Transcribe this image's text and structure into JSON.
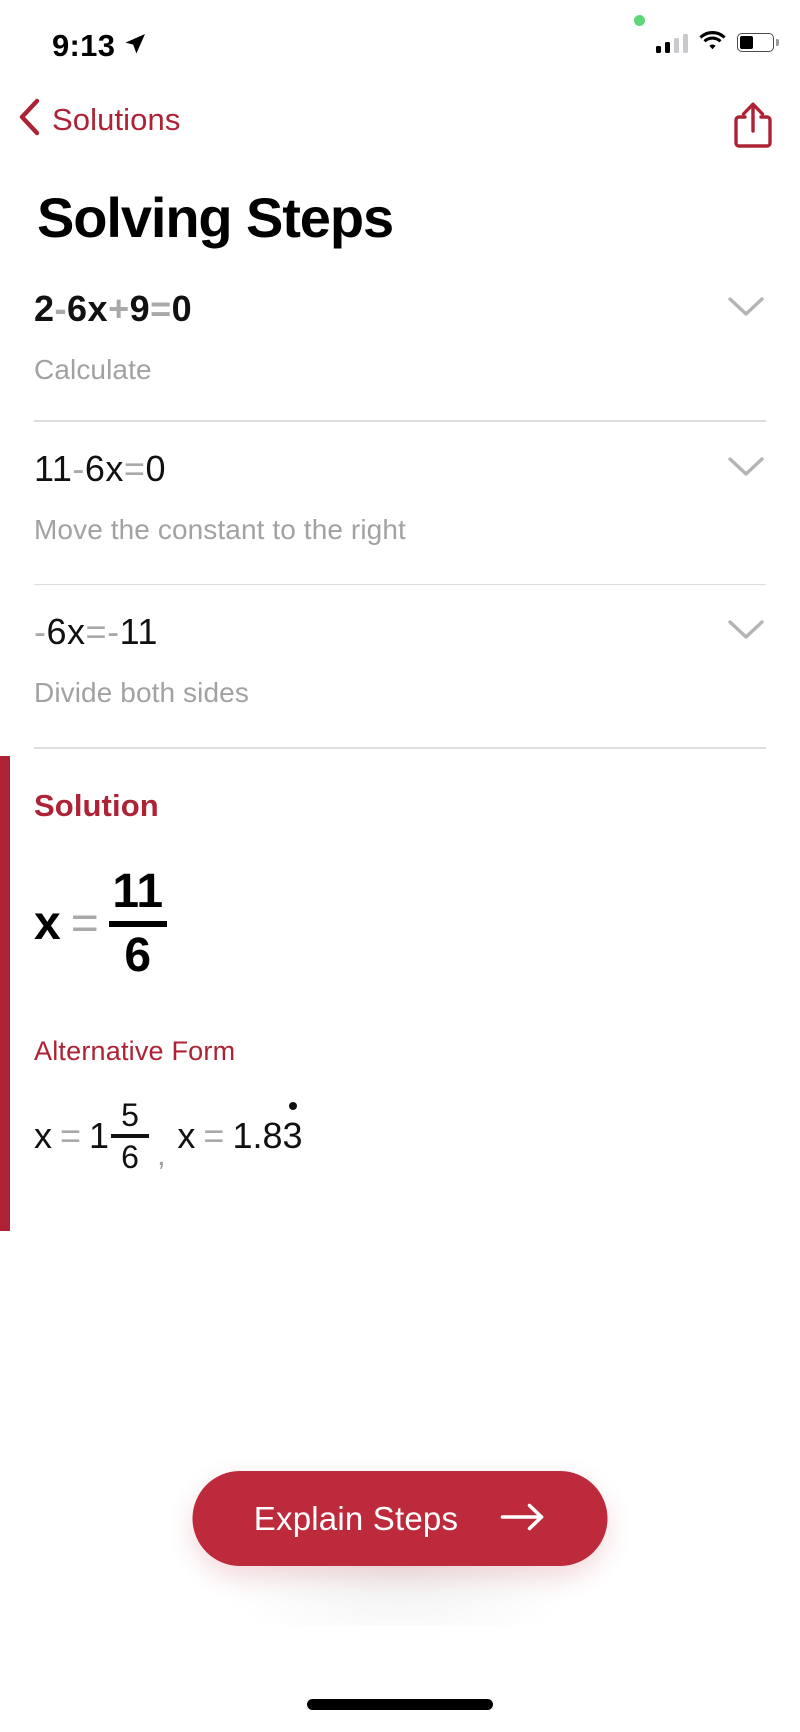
{
  "status_bar": {
    "time": "9:13",
    "location_icon": "location-arrow-icon",
    "recording_indicator": "green-dot-icon",
    "cellular_icon": "cellular-bars-icon",
    "wifi_icon": "wifi-icon",
    "battery_icon": "battery-icon"
  },
  "nav": {
    "back_label": "Solutions",
    "back_icon": "chevron-left-icon",
    "share_icon": "share-icon"
  },
  "page": {
    "title": "Solving Steps"
  },
  "steps": [
    {
      "equation": [
        {
          "t": "2",
          "k": "num"
        },
        {
          "t": "-",
          "k": "op"
        },
        {
          "t": "6x",
          "k": "num"
        },
        {
          "t": "+",
          "k": "op"
        },
        {
          "t": "9",
          "k": "num"
        },
        {
          "t": "=",
          "k": "op"
        },
        {
          "t": "0",
          "k": "num"
        }
      ],
      "equation_text": "2 - 6x + 9 = 0",
      "description": "Calculate",
      "expand_icon": "chevron-down-icon",
      "bold": true
    },
    {
      "equation": [
        {
          "t": "11",
          "k": "num"
        },
        {
          "t": "-",
          "k": "op"
        },
        {
          "t": "6x",
          "k": "num"
        },
        {
          "t": "=",
          "k": "op"
        },
        {
          "t": "0",
          "k": "num"
        }
      ],
      "equation_text": "11 - 6x = 0",
      "description": "Move the constant to the right",
      "expand_icon": "chevron-down-icon",
      "bold": false
    },
    {
      "equation": [
        {
          "t": "-",
          "k": "op"
        },
        {
          "t": "6x",
          "k": "num"
        },
        {
          "t": "=",
          "k": "op"
        },
        {
          "t": "-",
          "k": "op"
        },
        {
          "t": "11",
          "k": "num"
        }
      ],
      "equation_text": "-6x = -11",
      "description": "Divide both sides",
      "expand_icon": "chevron-down-icon",
      "bold": false
    }
  ],
  "solution": {
    "heading": "Solution",
    "variable": "x",
    "equals": "=",
    "numerator": "11",
    "denominator": "6",
    "alternative_heading": "Alternative Form",
    "alt_var_1": "x",
    "alt_eq_1": "=",
    "alt_whole_1": "1",
    "alt_num_1": "5",
    "alt_den_1": "6",
    "separator": ",",
    "alt_var_2": "x",
    "alt_eq_2": "=",
    "alt_value_2_prefix": "1.8",
    "alt_value_2_repeat": "3",
    "alt_value_2_text": "1.83"
  },
  "cta": {
    "label": "Explain Steps",
    "arrow_icon": "arrow-right-icon"
  },
  "colors": {
    "accent_red": "#AD2335",
    "button_red": "#BC2A3C",
    "muted_gray": "#A2A2A2",
    "operator_gray": "#A9A9A9",
    "divider": "#DEDEDE"
  }
}
